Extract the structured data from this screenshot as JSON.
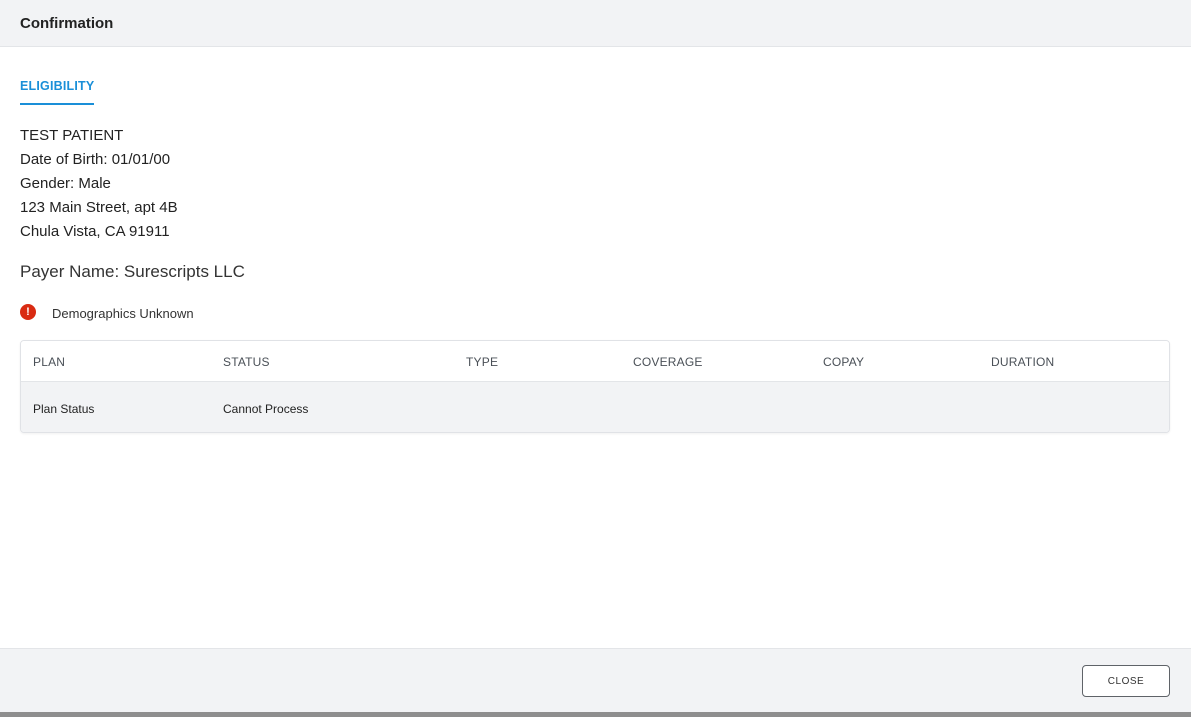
{
  "header": {
    "title": "Confirmation"
  },
  "tab": {
    "label": "ELIGIBILITY"
  },
  "patient": {
    "name": "TEST PATIENT",
    "dob": "Date of Birth: 01/01/00",
    "gender": "Gender: Male",
    "address_line1": "123 Main Street, apt 4B",
    "address_line2": "Chula Vista, CA 91911"
  },
  "payer": {
    "label": "Payer Name: Surescripts LLC"
  },
  "warning": {
    "icon": "exclamation-circle-icon",
    "glyph": "!",
    "text": "Demographics Unknown",
    "color": "#d92b12"
  },
  "table": {
    "headers": [
      "PLAN",
      "STATUS",
      "TYPE",
      "COVERAGE",
      "COPAY",
      "DURATION"
    ],
    "rows": [
      [
        "Plan Status",
        "Cannot Process",
        "",
        "",
        "",
        ""
      ]
    ]
  },
  "footer": {
    "close_label": "CLOSE"
  },
  "colors": {
    "accent": "#1a8fd8",
    "header_bg": "#f2f3f5",
    "error": "#d92b12"
  }
}
